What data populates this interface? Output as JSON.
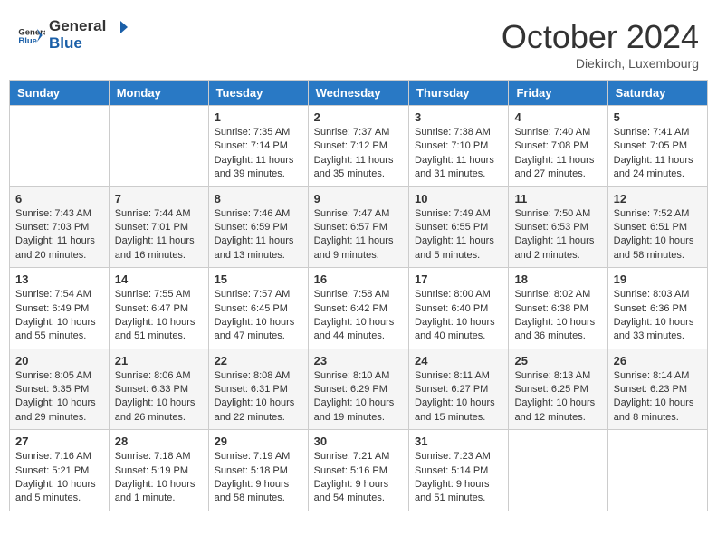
{
  "header": {
    "logo_general": "General",
    "logo_blue": "Blue",
    "month_title": "October 2024",
    "location": "Diekirch, Luxembourg"
  },
  "days_of_week": [
    "Sunday",
    "Monday",
    "Tuesday",
    "Wednesday",
    "Thursday",
    "Friday",
    "Saturday"
  ],
  "weeks": [
    [
      {
        "day": "",
        "info": ""
      },
      {
        "day": "",
        "info": ""
      },
      {
        "day": "1",
        "info": "Sunrise: 7:35 AM\nSunset: 7:14 PM\nDaylight: 11 hours and 39 minutes."
      },
      {
        "day": "2",
        "info": "Sunrise: 7:37 AM\nSunset: 7:12 PM\nDaylight: 11 hours and 35 minutes."
      },
      {
        "day": "3",
        "info": "Sunrise: 7:38 AM\nSunset: 7:10 PM\nDaylight: 11 hours and 31 minutes."
      },
      {
        "day": "4",
        "info": "Sunrise: 7:40 AM\nSunset: 7:08 PM\nDaylight: 11 hours and 27 minutes."
      },
      {
        "day": "5",
        "info": "Sunrise: 7:41 AM\nSunset: 7:05 PM\nDaylight: 11 hours and 24 minutes."
      }
    ],
    [
      {
        "day": "6",
        "info": "Sunrise: 7:43 AM\nSunset: 7:03 PM\nDaylight: 11 hours and 20 minutes."
      },
      {
        "day": "7",
        "info": "Sunrise: 7:44 AM\nSunset: 7:01 PM\nDaylight: 11 hours and 16 minutes."
      },
      {
        "day": "8",
        "info": "Sunrise: 7:46 AM\nSunset: 6:59 PM\nDaylight: 11 hours and 13 minutes."
      },
      {
        "day": "9",
        "info": "Sunrise: 7:47 AM\nSunset: 6:57 PM\nDaylight: 11 hours and 9 minutes."
      },
      {
        "day": "10",
        "info": "Sunrise: 7:49 AM\nSunset: 6:55 PM\nDaylight: 11 hours and 5 minutes."
      },
      {
        "day": "11",
        "info": "Sunrise: 7:50 AM\nSunset: 6:53 PM\nDaylight: 11 hours and 2 minutes."
      },
      {
        "day": "12",
        "info": "Sunrise: 7:52 AM\nSunset: 6:51 PM\nDaylight: 10 hours and 58 minutes."
      }
    ],
    [
      {
        "day": "13",
        "info": "Sunrise: 7:54 AM\nSunset: 6:49 PM\nDaylight: 10 hours and 55 minutes."
      },
      {
        "day": "14",
        "info": "Sunrise: 7:55 AM\nSunset: 6:47 PM\nDaylight: 10 hours and 51 minutes."
      },
      {
        "day": "15",
        "info": "Sunrise: 7:57 AM\nSunset: 6:45 PM\nDaylight: 10 hours and 47 minutes."
      },
      {
        "day": "16",
        "info": "Sunrise: 7:58 AM\nSunset: 6:42 PM\nDaylight: 10 hours and 44 minutes."
      },
      {
        "day": "17",
        "info": "Sunrise: 8:00 AM\nSunset: 6:40 PM\nDaylight: 10 hours and 40 minutes."
      },
      {
        "day": "18",
        "info": "Sunrise: 8:02 AM\nSunset: 6:38 PM\nDaylight: 10 hours and 36 minutes."
      },
      {
        "day": "19",
        "info": "Sunrise: 8:03 AM\nSunset: 6:36 PM\nDaylight: 10 hours and 33 minutes."
      }
    ],
    [
      {
        "day": "20",
        "info": "Sunrise: 8:05 AM\nSunset: 6:35 PM\nDaylight: 10 hours and 29 minutes."
      },
      {
        "day": "21",
        "info": "Sunrise: 8:06 AM\nSunset: 6:33 PM\nDaylight: 10 hours and 26 minutes."
      },
      {
        "day": "22",
        "info": "Sunrise: 8:08 AM\nSunset: 6:31 PM\nDaylight: 10 hours and 22 minutes."
      },
      {
        "day": "23",
        "info": "Sunrise: 8:10 AM\nSunset: 6:29 PM\nDaylight: 10 hours and 19 minutes."
      },
      {
        "day": "24",
        "info": "Sunrise: 8:11 AM\nSunset: 6:27 PM\nDaylight: 10 hours and 15 minutes."
      },
      {
        "day": "25",
        "info": "Sunrise: 8:13 AM\nSunset: 6:25 PM\nDaylight: 10 hours and 12 minutes."
      },
      {
        "day": "26",
        "info": "Sunrise: 8:14 AM\nSunset: 6:23 PM\nDaylight: 10 hours and 8 minutes."
      }
    ],
    [
      {
        "day": "27",
        "info": "Sunrise: 7:16 AM\nSunset: 5:21 PM\nDaylight: 10 hours and 5 minutes."
      },
      {
        "day": "28",
        "info": "Sunrise: 7:18 AM\nSunset: 5:19 PM\nDaylight: 10 hours and 1 minute."
      },
      {
        "day": "29",
        "info": "Sunrise: 7:19 AM\nSunset: 5:18 PM\nDaylight: 9 hours and 58 minutes."
      },
      {
        "day": "30",
        "info": "Sunrise: 7:21 AM\nSunset: 5:16 PM\nDaylight: 9 hours and 54 minutes."
      },
      {
        "day": "31",
        "info": "Sunrise: 7:23 AM\nSunset: 5:14 PM\nDaylight: 9 hours and 51 minutes."
      },
      {
        "day": "",
        "info": ""
      },
      {
        "day": "",
        "info": ""
      }
    ]
  ]
}
